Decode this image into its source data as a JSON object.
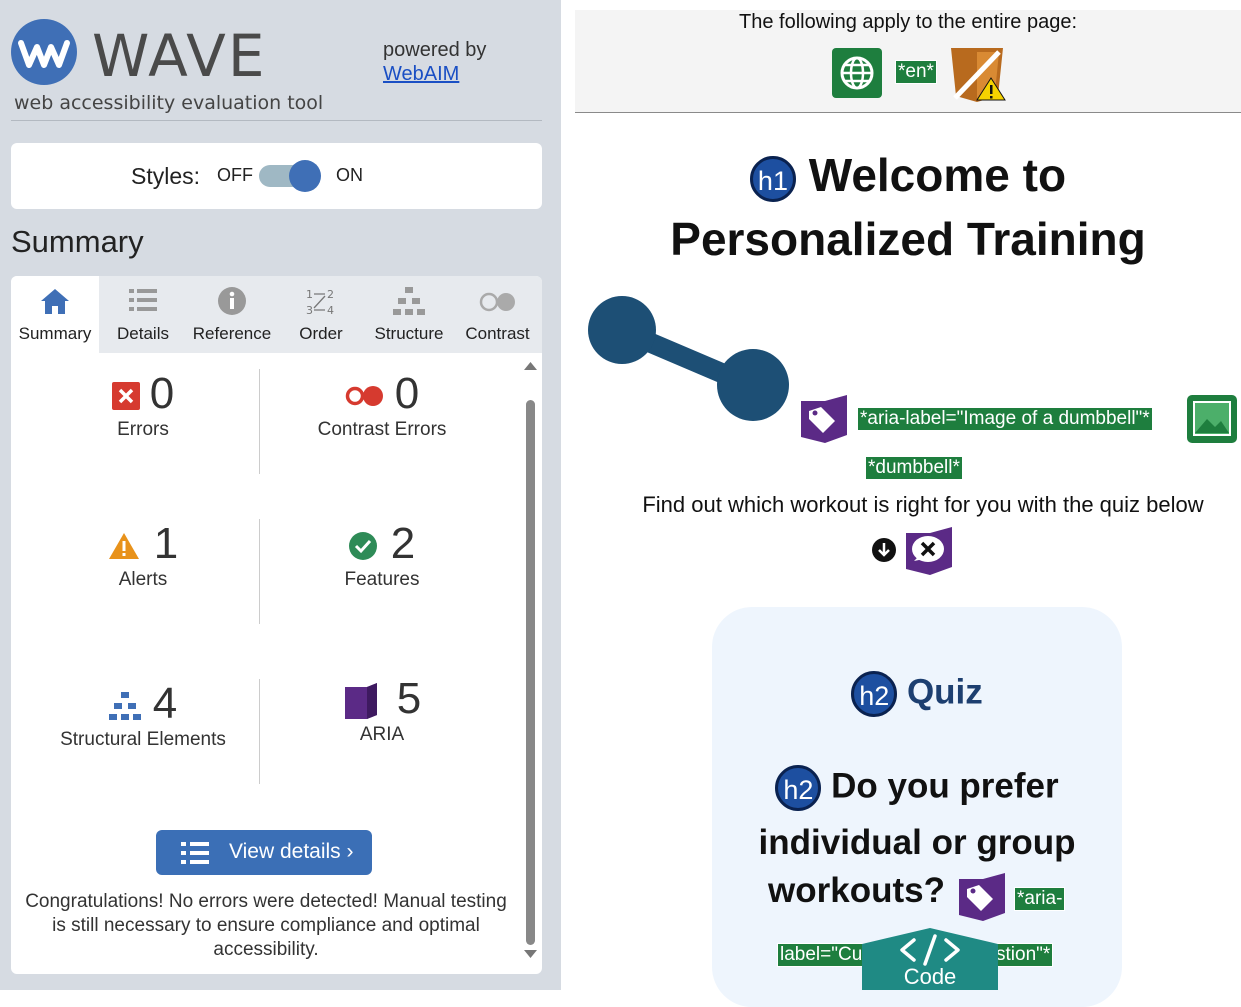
{
  "sidebar": {
    "app_name": "WAVE",
    "tagline": "web accessibility evaluation tool",
    "powered_by": "powered by",
    "powered_link": "WebAIM",
    "styles_label": "Styles:",
    "styles_off": "OFF",
    "styles_on": "ON",
    "summary_heading": "Summary",
    "tabs": [
      {
        "label": "Summary",
        "icon": "home-icon"
      },
      {
        "label": "Details",
        "icon": "list-icon"
      },
      {
        "label": "Reference",
        "icon": "info-icon"
      },
      {
        "label": "Order",
        "icon": "order-icon"
      },
      {
        "label": "Structure",
        "icon": "structure-icon"
      },
      {
        "label": "Contrast",
        "icon": "contrast-icon"
      }
    ],
    "stats": {
      "errors": {
        "count": "0",
        "label": "Errors"
      },
      "contrast_errors": {
        "count": "0",
        "label": "Contrast Errors"
      },
      "alerts": {
        "count": "1",
        "label": "Alerts"
      },
      "features": {
        "count": "2",
        "label": "Features"
      },
      "structural": {
        "count": "4",
        "label": "Structural Elements"
      },
      "aria": {
        "count": "5",
        "label": "ARIA"
      }
    },
    "view_details": "View details ›",
    "congrats": "Congratulations! No errors were detected! Manual testing is still necessary to ensure compliance and optimal accessibility."
  },
  "page": {
    "applies_text": "The following apply to the entire page:",
    "lang_tag": "*en*",
    "h1_badge": "h1",
    "h1_line1": "Welcome to",
    "h1_line2": "Personalized Training",
    "aria_label_tag": "*aria-label=\"Image of a dumbbell\"*",
    "dumbbell_tag": "*dumbbell*",
    "intro_text": "Find out which workout is right for you with the quiz below",
    "h2_badge": "h2",
    "quiz_heading": "Quiz",
    "question_line1": "Do you prefer",
    "question_line2": "individual or group",
    "question_line3": "workouts?",
    "aria_tag_part1": "*aria-",
    "aria_tag_part2_left": "label=\"Cu",
    "aria_tag_part2_right": "stion\"*",
    "code_label": "Code"
  },
  "colors": {
    "brand_blue": "#3f6fb6",
    "error_red": "#d63a2f",
    "alert_orange": "#e8921b",
    "feature_green": "#2e8b57",
    "aria_purple": "#5b2a86",
    "tag_green": "#1e7e3e",
    "code_teal": "#1f8a84"
  }
}
